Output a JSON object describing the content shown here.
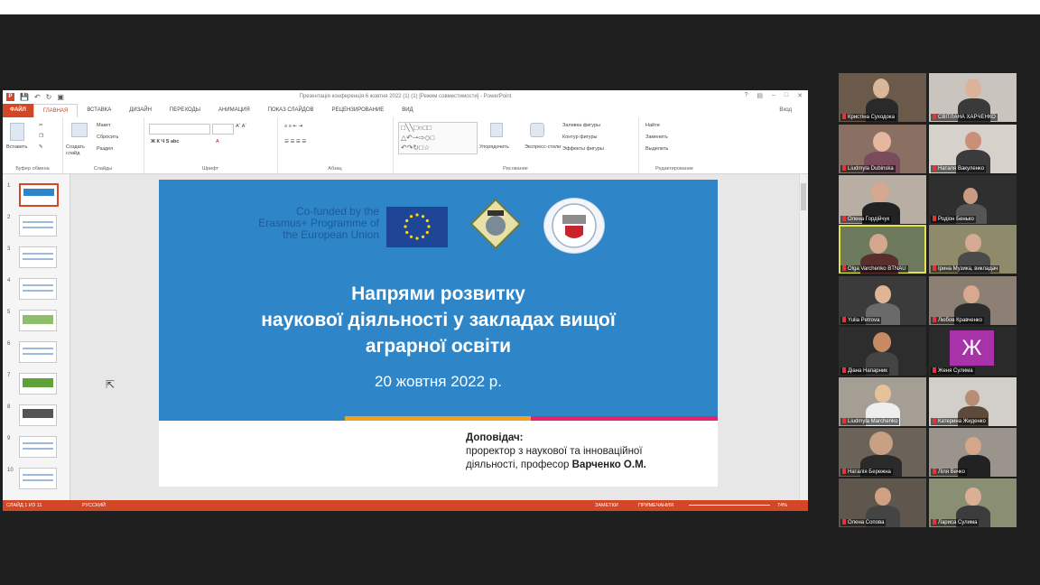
{
  "powerpoint": {
    "doc_title": "Презентація конференція 6 жовтня 2022 (1) (1) [Режим совместимости] - PowerPoint",
    "tabs": [
      "ФАЙЛ",
      "ГЛАВНАЯ",
      "ВСТАВКА",
      "ДИЗАЙН",
      "ПЕРЕХОДЫ",
      "АНИМАЦИЯ",
      "ПОКАЗ СЛАЙДОВ",
      "РЕЦЕНЗИРОВАНИЕ",
      "ВИД"
    ],
    "sign_in": "Вход",
    "ribbon_groups": {
      "clipboard": "Буфер обмена",
      "slides": "Слайды",
      "font": "Шрифт",
      "paragraph": "Абзац",
      "drawing": "Рисование",
      "editing": "Редактирование"
    },
    "ribbon_buttons": {
      "paste": "Вставить",
      "new_slide": "Создать слайд",
      "layout": "Макет",
      "reset": "Сбросить",
      "section": "Раздел",
      "arrange": "Упорядочить",
      "quick_styles": "Экспресс-стили",
      "shape_fill": "Заливка фигуры",
      "shape_outline": "Контур фигуры",
      "shape_effects": "Эффекты фигуры",
      "find": "Найти",
      "replace": "Заменить",
      "select": "Выделить"
    },
    "thumb_numbers": [
      "1",
      "2",
      "3",
      "4",
      "5",
      "6",
      "7",
      "8",
      "9",
      "10"
    ],
    "slide": {
      "eu_text": "Co-funded by the Erasmus+ Programme of the European Union",
      "title_line1": "Напрями розвитку",
      "title_line2": "наукової діяльності у закладах вищої",
      "title_line3": "аграрної освіти",
      "date": "20 жовтня 2022 р.",
      "speaker_label": "Доповідач:",
      "speaker_line1": "проректор з наукової та інноваційної",
      "speaker_line2": "діяльності, професор",
      "speaker_name": "Варченко О.М."
    },
    "statusbar": {
      "slide_info": "СЛАЙД 1 ИЗ 11",
      "language": "РУССКИЙ",
      "notes": "ЗАМЕТКИ",
      "comments": "ПРИМЕЧАНИЯ",
      "zoom": "74%"
    },
    "accent_color": "#d24726",
    "slide_blue": "#2e86c8"
  },
  "participants": [
    {
      "name": "Кристіна Суходока"
    },
    {
      "name": "СВІТЛАНА ХАРЧЕНКО"
    },
    {
      "name": "Liudmyla Dubinska"
    },
    {
      "name": "Наталя Вакуленко"
    },
    {
      "name": "Олена Гордійчук"
    },
    {
      "name": "Родіон Бенько"
    },
    {
      "name": "Olga Varchenko BTNAU"
    },
    {
      "name": "Ірина Музика, викладач"
    },
    {
      "name": "Yulia Petrova"
    },
    {
      "name": "Любов Кравченко"
    },
    {
      "name": "Діана Напарник"
    },
    {
      "name": "Женя Сулима",
      "letter": "Ж"
    },
    {
      "name": "Liudmyla Marchenko"
    },
    {
      "name": "Катерина Жиденко"
    },
    {
      "name": "Наталія Бережна"
    },
    {
      "name": "Ліля Вечко"
    },
    {
      "name": "Олена Сопова"
    },
    {
      "name": "Лариса Сулима"
    }
  ]
}
